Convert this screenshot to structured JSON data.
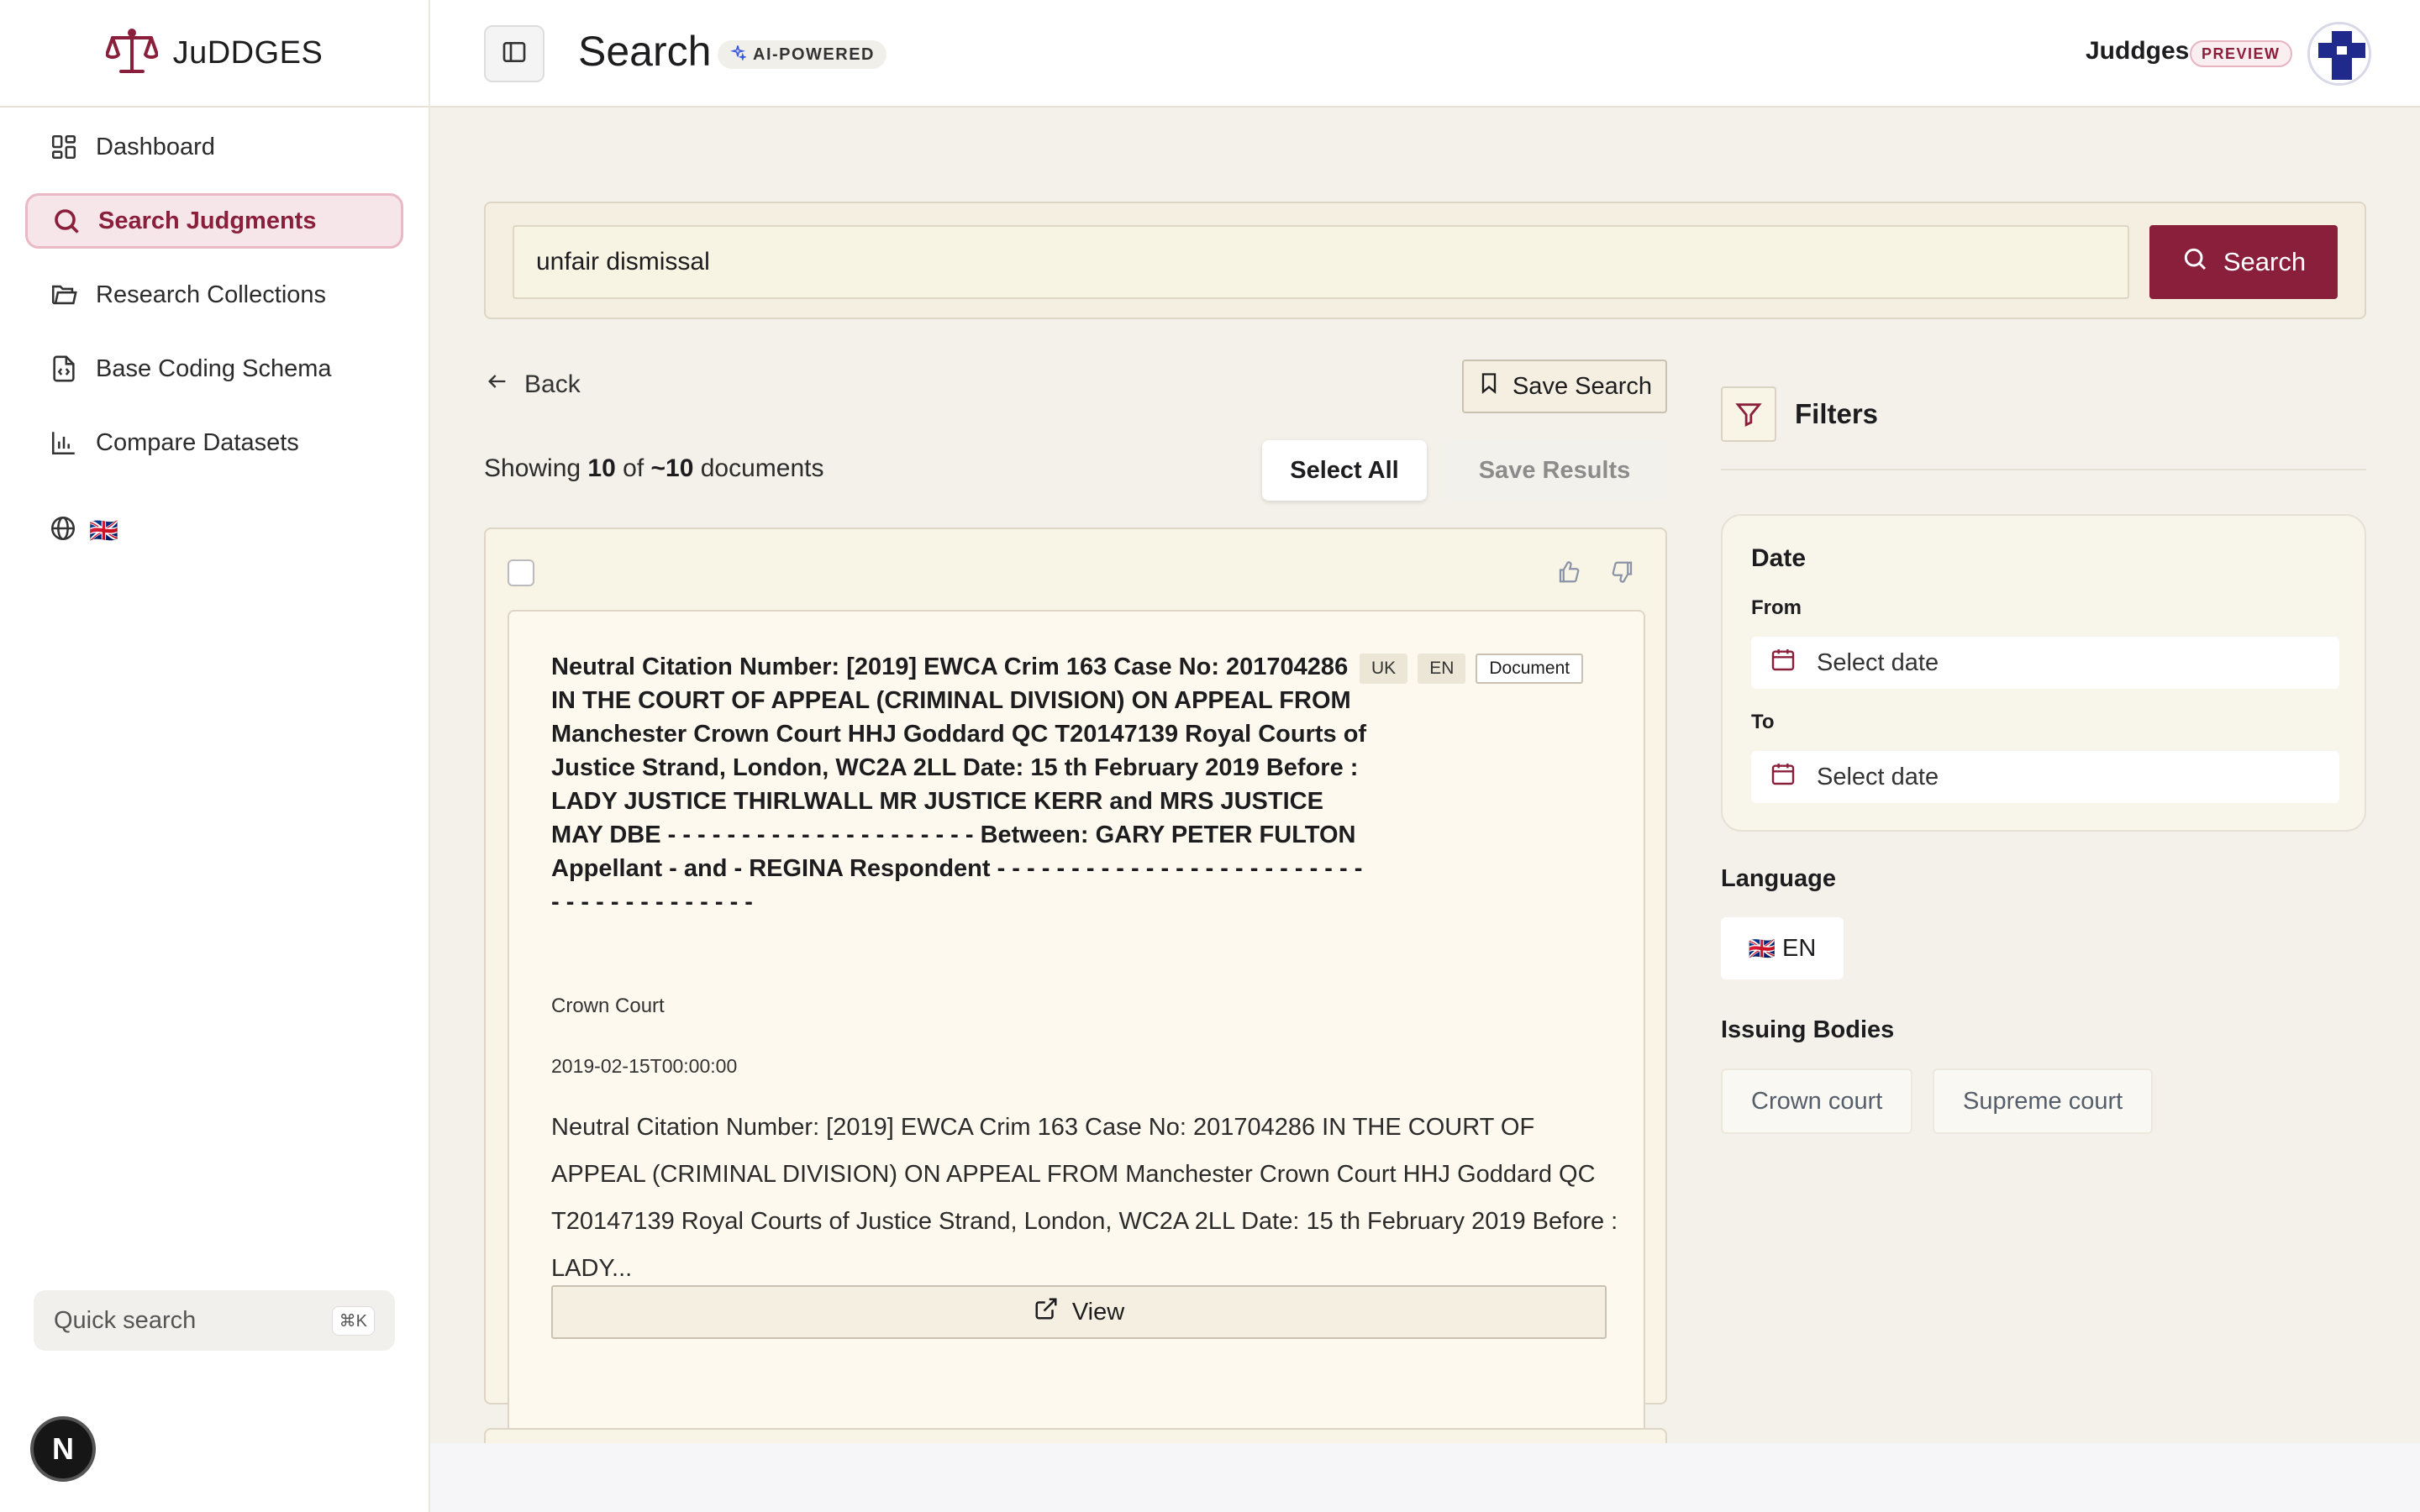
{
  "brand": {
    "name": "JuDDGES"
  },
  "sidebar": {
    "items": [
      {
        "label": "Dashboard",
        "icon": "dashboard-icon",
        "active": false
      },
      {
        "label": "Search Judgments",
        "icon": "search-icon",
        "active": true
      },
      {
        "label": "Research Collections",
        "icon": "folder-icon",
        "active": false
      },
      {
        "label": "Base Coding Schema",
        "icon": "file-code-icon",
        "active": false
      },
      {
        "label": "Compare Datasets",
        "icon": "bar-chart-icon",
        "active": false
      }
    ],
    "language_flag": "🇬🇧",
    "quick_search": {
      "placeholder": "Quick search",
      "shortcut": "⌘K"
    },
    "n_badge": "N"
  },
  "header": {
    "title": "Search",
    "badge": "AI-POWERED",
    "user_name": "Juddges",
    "user_badge": "PREVIEW"
  },
  "search": {
    "value": "unfair dismissal",
    "button_label": "Search"
  },
  "results": {
    "back_label": "Back",
    "save_search_label": "Save Search",
    "showing_prefix": "Showing",
    "showing_count": "10",
    "showing_of": "of",
    "showing_total": "~10",
    "showing_suffix": "documents",
    "select_all_label": "Select All",
    "save_results_label": "Save Results",
    "card": {
      "title": "Neutral Citation Number: [2019] EWCA Crim 163 Case No: 201704286 IN THE COURT OF APPEAL (CRIMINAL DIVISION) ON APPEAL FROM Manchester Crown Court HHJ Goddard QC T20147139 Royal Courts of Justice Strand, London, WC2A 2LL Date: 15 th February 2019 Before : LADY JUSTICE THIRLWALL MR JUSTICE KERR and MRS JUSTICE MAY DBE - - - - - - - - - - - - - - - - - - - - - Between: GARY PETER FULTON Appellant - and - REGINA Respondent - - - - - - - - - - - - - - - - - - - - - - - - - - - - - - - - - - - - - - -",
      "tags": [
        "UK",
        "EN",
        "Document"
      ],
      "court": "Crown Court",
      "date": "2019-02-15T00:00:00",
      "excerpt": "Neutral Citation Number: [2019] EWCA Crim 163 Case No: 201704286 IN THE COURT OF APPEAL (CRIMINAL DIVISION) ON APPEAL FROM Manchester Crown Court HHJ Goddard QC T20147139 Royal Courts of Justice Strand, London, WC2A 2LL Date: 15 th February 2019 Before : LADY...",
      "view_label": "View"
    }
  },
  "filters": {
    "title": "Filters",
    "date": {
      "heading": "Date",
      "from_label": "From",
      "to_label": "To",
      "placeholder": "Select date"
    },
    "language": {
      "heading": "Language",
      "flag": "🇬🇧",
      "value": "EN"
    },
    "issuing_bodies": {
      "heading": "Issuing Bodies",
      "options": [
        "Crown court",
        "Supreme court"
      ]
    }
  },
  "colors": {
    "accent": "#8a1f3c",
    "panel": "#f4efe0",
    "background": "#f4f1ea"
  }
}
